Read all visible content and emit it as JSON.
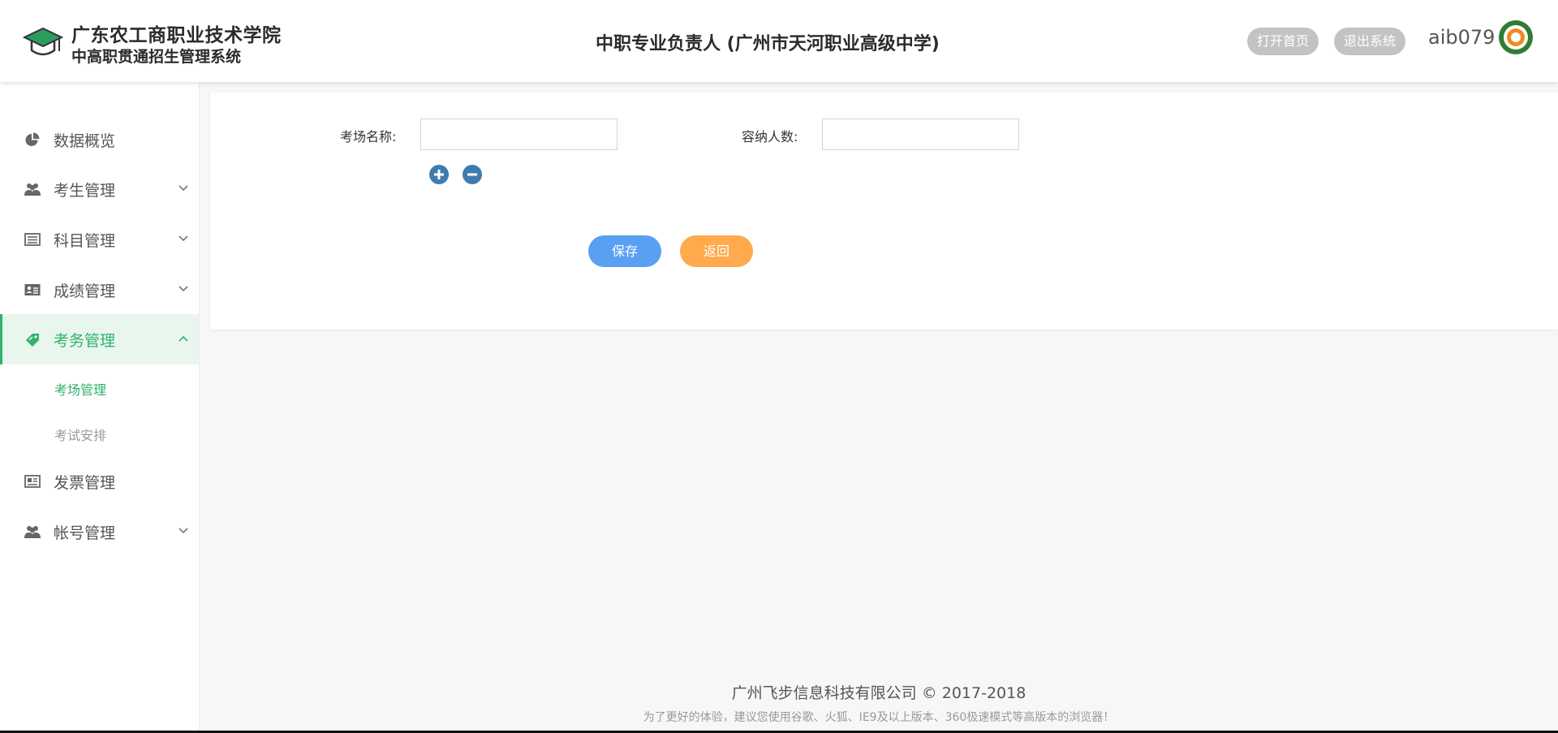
{
  "header": {
    "brand_line1": "广东农工商职业技术学院",
    "brand_line2": "中高职贯通招生管理系统",
    "title": "中职专业负责人 (广州市天河职业高级中学)",
    "open_home_label": "打开首页",
    "exit_label": "退出系统",
    "username": "aib079"
  },
  "sidebar": {
    "items": [
      {
        "label": "数据概览",
        "icon": "pie-chart-icon"
      },
      {
        "label": "考生管理",
        "icon": "users-icon"
      },
      {
        "label": "科目管理",
        "icon": "list-card-icon"
      },
      {
        "label": "成绩管理",
        "icon": "id-card-icon"
      },
      {
        "label": "考务管理",
        "icon": "ticket-icon"
      },
      {
        "label": "发票管理",
        "icon": "receipt-icon"
      },
      {
        "label": "帐号管理",
        "icon": "users-icon"
      }
    ],
    "sub_items": [
      {
        "label": "考场管理"
      },
      {
        "label": "考试安排"
      }
    ]
  },
  "form": {
    "room_name_label": "考场名称:",
    "room_name_value": "",
    "capacity_label": "容纳人数:",
    "capacity_value": "",
    "save_label": "保存",
    "back_label": "返回"
  },
  "footer": {
    "company": "广州飞步信息科技有限公司 © 2017-2018",
    "tip": "为了更好的体验，建议您使用谷歌、火狐、IE9及以上版本、360极速模式等高版本的浏览器！"
  },
  "colors": {
    "accent_green": "#2fb36b",
    "save_blue": "#5aa0f2",
    "back_orange": "#feaa4d",
    "pill_gray": "#c3c3c3"
  }
}
